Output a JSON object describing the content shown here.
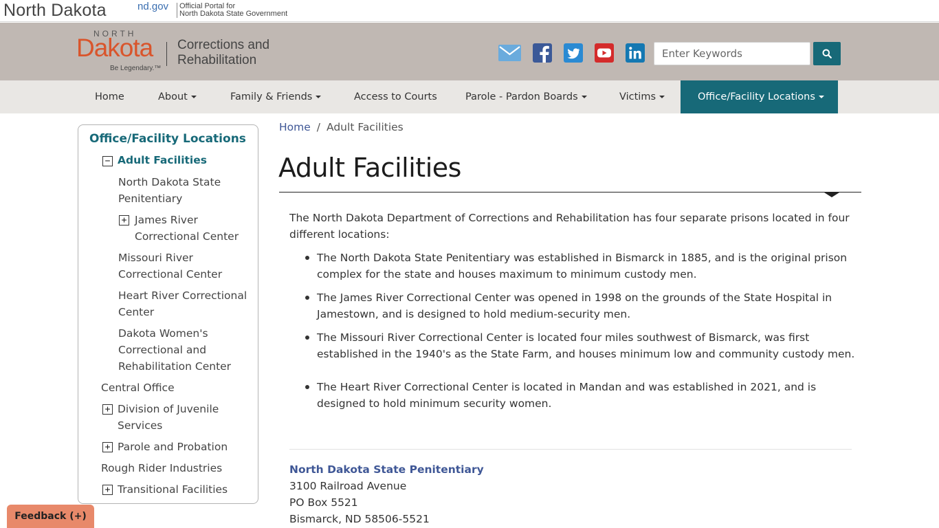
{
  "portal": {
    "title": "North Dakota",
    "ndgov": "nd.gov",
    "desc_line1": "Official Portal for",
    "desc_line2": "North Dakota State Government"
  },
  "logo": {
    "north": "NORTH",
    "dakota": "Dakota",
    "tagline": "Be Legendary.™",
    "dept_line1": "Corrections and",
    "dept_line2": "Rehabilitation"
  },
  "social": [
    {
      "name": "email-icon",
      "color": "#6aabdd"
    },
    {
      "name": "facebook-icon",
      "color": "#3b5998"
    },
    {
      "name": "twitter-icon",
      "color": "#2a8ad3"
    },
    {
      "name": "youtube-icon",
      "color": "#d42b2b"
    },
    {
      "name": "linkedin-icon",
      "color": "#1478b2"
    }
  ],
  "search": {
    "placeholder": "Enter Keywords"
  },
  "nav": {
    "home": "Home",
    "about": "About",
    "family": "Family & Friends",
    "courts": "Access to Courts",
    "parole": "Parole - Pardon Boards",
    "victims": "Victims",
    "locations": "Office/Facility Locations"
  },
  "sidebar": {
    "title": "Office/Facility Locations",
    "adult": "Adult Facilities",
    "ndsp_1": "North Dakota State",
    "ndsp_2": "Penitentiary",
    "jrcc_1": "James River",
    "jrcc_2": "Correctional Center",
    "mrcc_1": "Missouri River",
    "mrcc_2": "Correctional Center",
    "hrcc_1": "Heart River Correctional",
    "hrcc_2": "Center",
    "dwcrc_1": "Dakota Women's",
    "dwcrc_2": "Correctional and",
    "dwcrc_3": "Rehabilitation Center",
    "central": "Central Office",
    "djs_1": "Division of Juvenile",
    "djs_2": "Services",
    "parole": "Parole and Probation",
    "rough": "Rough Rider Industries",
    "transitional": "Transitional Facilities",
    "toggle_minus": "−",
    "toggle_plus": "+"
  },
  "breadcrumb": {
    "home": "Home",
    "separator": "/",
    "current": "Adult Facilities"
  },
  "page": {
    "title": "Adult Facilities",
    "intro": "The North Dakota Department of Corrections and Rehabilitation has four separate prisons located in four different locations:",
    "bullets": [
      "The North Dakota State Penitentiary was established in Bismarck in 1885, and is the original prison complex for the state and houses maximum to minimum custody men.",
      "The James River Correctional Center was opened in 1998 on the grounds of the State Hospital in Jamestown, and is designed to hold medium-security men.",
      "The Missouri River Correctional Center is located four miles southwest of Bismarck, was first established in the 1940's as the State Farm, and houses minimum low and community custody men.",
      "The Heart River Correctional Center is located in Mandan and was established in 2021, and is designed to hold minimum security women."
    ]
  },
  "facility": {
    "name": "North Dakota State Penitentiary",
    "address1": "3100 Railroad Avenue",
    "address2": "PO Box 5521",
    "address3": "Bismarck, ND 58506-5521"
  },
  "feedback": {
    "label": "Feedback (+)"
  },
  "colors": {
    "accent": "#176978",
    "header_bg": "#c0b8b3",
    "nav_bg": "#e9e7e4",
    "link": "#3f5796",
    "brand_orange": "#d9552c",
    "feedback_bg": "#e8896a"
  }
}
